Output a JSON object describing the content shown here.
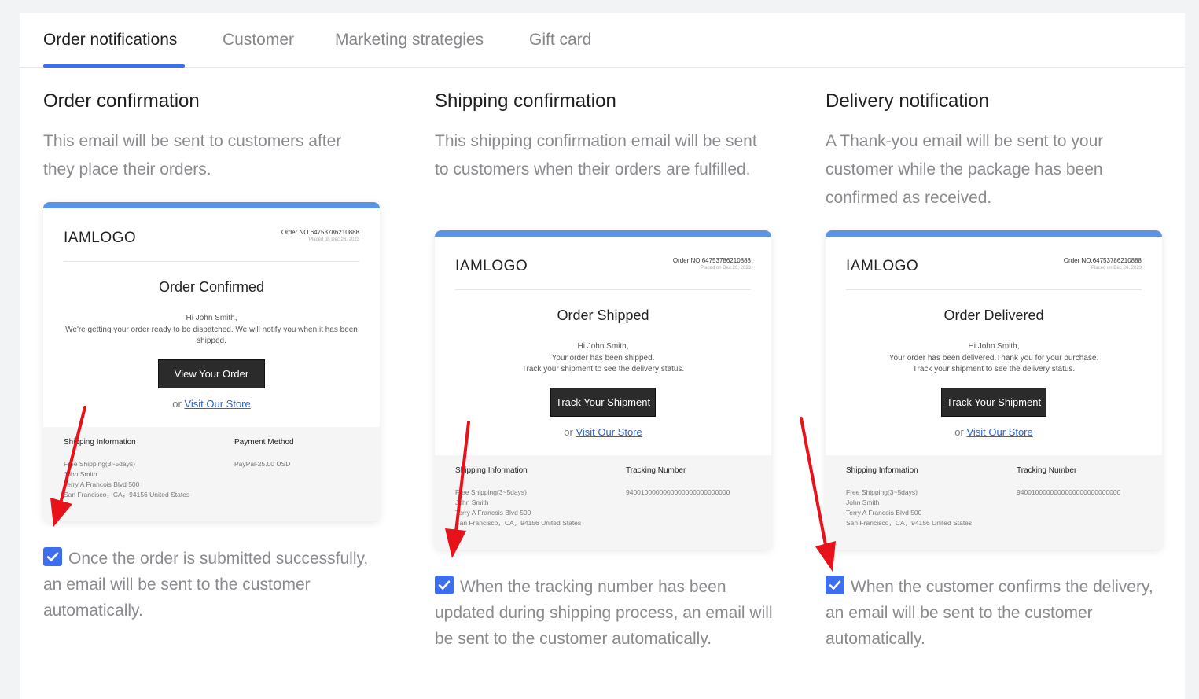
{
  "tabs": [
    "Order notifications",
    "Customer",
    "Marketing strategies",
    "Gift card"
  ],
  "active_tab": "Order notifications",
  "colors": {
    "accent": "#3d6ef0",
    "card_bar": "#5b93e6",
    "arrow": "#e8121a",
    "button": "#2b2b2b"
  },
  "columns": [
    {
      "title": "Order confirmation",
      "description": "This email will be sent to customers after they place their orders.",
      "email": {
        "logo": "IAMLOGO",
        "order_no": "Order NO.64753786210888",
        "placed_on": "Placed on Dec 26, 2023",
        "heading": "Order Confirmed",
        "greeting": "Hi  John Smith,",
        "message_lines": [
          "We're getting your order ready to be dispatched. We will notify you when it has been shipped."
        ],
        "button": "View Your Order",
        "or": "or",
        "link": "Visit Our Store",
        "left_title": "Shipping Information",
        "left_lines": [
          "Free Shipping(3~5days)",
          "John Smith",
          "Terry A Francois Blvd 500",
          "San Francisco，CA，94156 United States"
        ],
        "right_title": "Payment Method",
        "right_value": "PayPal-25.00 USD"
      },
      "checked": true,
      "check_label": "Once the order is submitted successfully, an email will be sent to the customer automatically."
    },
    {
      "title": "Shipping confirmation",
      "description": "This shipping confirmation email will be sent to customers when their orders are fulfilled.",
      "email": {
        "logo": "IAMLOGO",
        "order_no": "Order NO.64753786210888",
        "placed_on": "Placed on Dec 26, 2023",
        "heading": "Order Shipped",
        "greeting": "Hi  John Smith,",
        "message_lines": [
          "Your order has been shipped.",
          "Track your shipment to see the delivery status."
        ],
        "button": "Track Your Shipment",
        "or": "or",
        "link": "Visit Our Store",
        "left_title": "Shipping Information",
        "left_lines": [
          "Free Shipping(3~5days)",
          "John Smith",
          "Terry A Francois Blvd 500",
          "San Francisco，CA，94156 United States"
        ],
        "right_title": "Tracking Number",
        "right_value": "9400100000000000000000000000"
      },
      "checked": true,
      "check_label": "When the tracking number has been updated during shipping process, an email will be sent to the customer automatically."
    },
    {
      "title": "Delivery notification",
      "description": "A Thank-you email will be sent to your customer while the package has been confirmed as received.",
      "email": {
        "logo": "IAMLOGO",
        "order_no": "Order NO.64753786210888",
        "placed_on": "Placed on Dec 26, 2023",
        "heading": "Order Delivered",
        "greeting": "Hi  John Smith,",
        "message_lines": [
          "Your order has been delivered.Thank you for your purchase.",
          "Track your shipment to see the delivery status."
        ],
        "button": "Track Your Shipment",
        "or": "or",
        "link": "Visit Our Store",
        "left_title": "Shipping Information",
        "left_lines": [
          "Free Shipping(3~5days)",
          "John Smith",
          "Terry A Francois Blvd 500",
          "San Francisco，CA，94156 United States"
        ],
        "right_title": "Tracking Number",
        "right_value": "9400100000000000000000000000"
      },
      "checked": true,
      "check_label": "When the customer confirms the delivery, an email will be sent to the customer automatically."
    }
  ]
}
